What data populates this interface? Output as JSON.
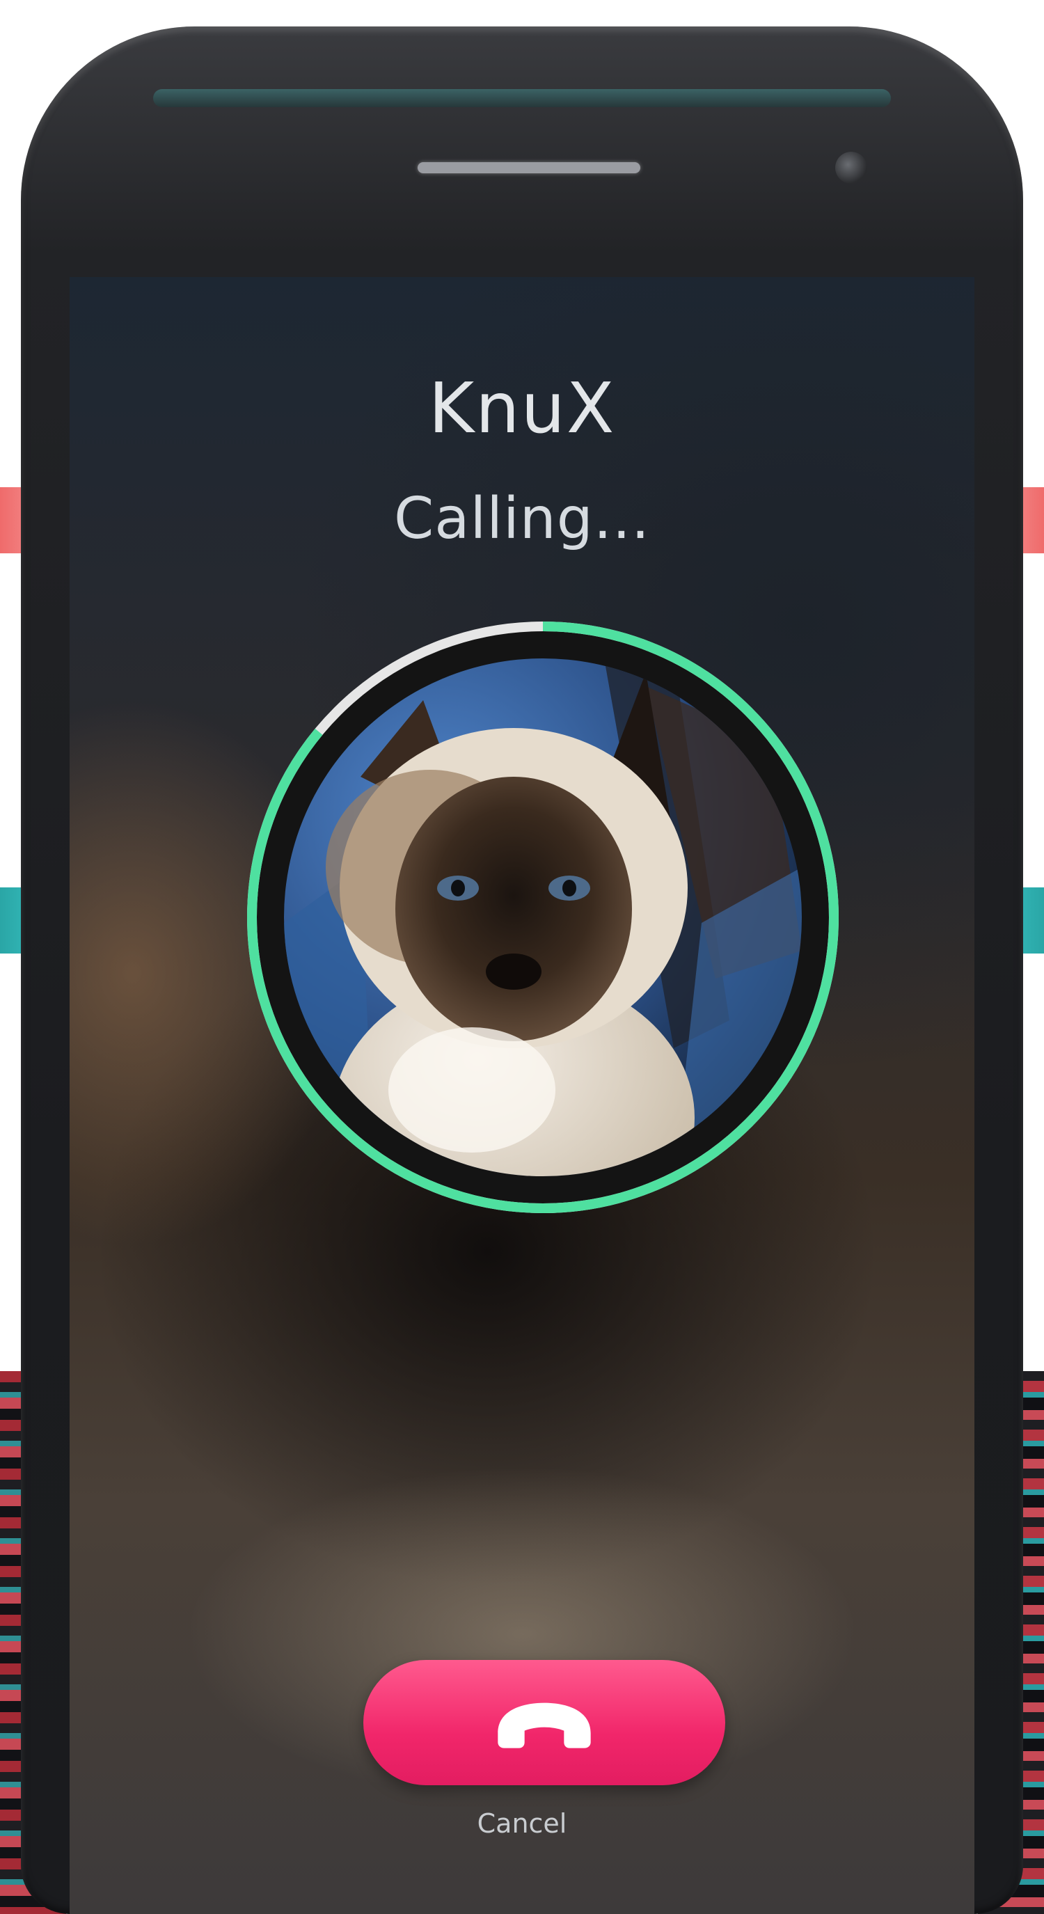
{
  "call": {
    "caller_name": "KnuX",
    "status": "Calling...",
    "ring_progress": 0.86,
    "avatar_icon": "cat-photo-avatar"
  },
  "actions": {
    "cancel_label": "Cancel",
    "end_call_icon": "phone-hangup-icon"
  },
  "colors": {
    "ring_progress": "#4fe0a0",
    "ring_track": "#e6e6e6",
    "end_call": "#f1266a"
  }
}
